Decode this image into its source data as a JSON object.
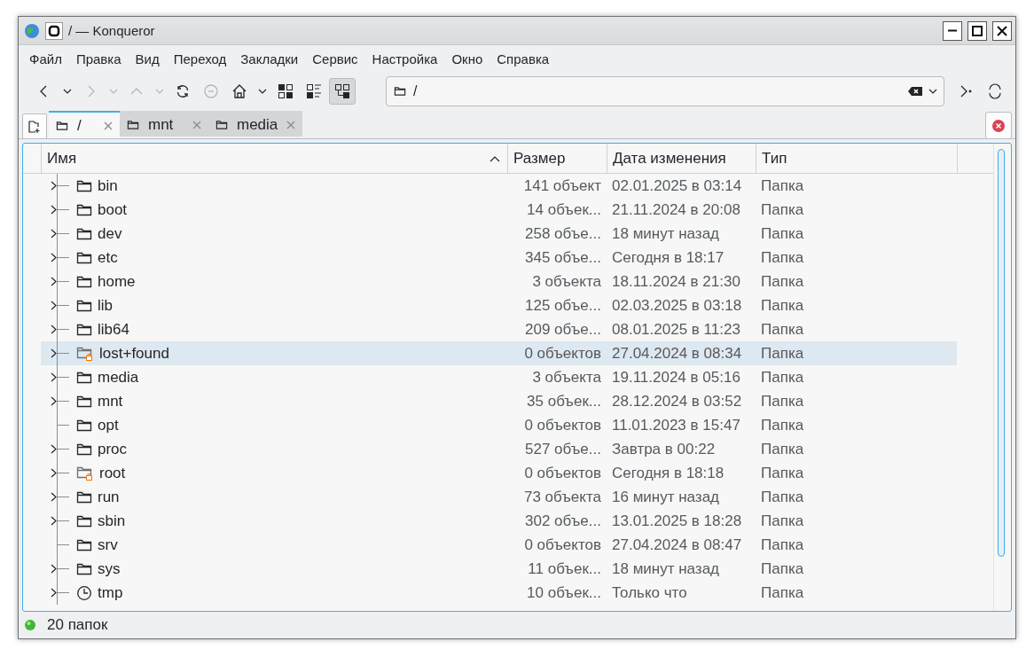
{
  "window": {
    "title": "/ — Konqueror"
  },
  "menu": [
    "Файл",
    "Правка",
    "Вид",
    "Переход",
    "Закладки",
    "Сервис",
    "Настройка",
    "Окно",
    "Справка"
  ],
  "toolbar": [
    {
      "kind": "back",
      "disabled": false,
      "selected": false
    },
    {
      "kind": "dropdown",
      "disabled": false,
      "selected": false
    },
    {
      "kind": "forward",
      "disabled": true,
      "selected": false
    },
    {
      "kind": "dropdown",
      "disabled": true,
      "selected": false
    },
    {
      "kind": "up",
      "disabled": true,
      "selected": false
    },
    {
      "kind": "dropdown",
      "disabled": true,
      "selected": false
    },
    {
      "kind": "reload",
      "disabled": false,
      "selected": false
    },
    {
      "kind": "stop",
      "disabled": true,
      "selected": false
    },
    {
      "kind": "home",
      "disabled": false,
      "selected": false
    },
    {
      "kind": "dropdown",
      "disabled": false,
      "selected": false
    },
    {
      "kind": "icons",
      "disabled": false,
      "selected": false
    },
    {
      "kind": "details",
      "disabled": false,
      "selected": false
    },
    {
      "kind": "tree",
      "disabled": false,
      "selected": true
    }
  ],
  "location": {
    "value": "/"
  },
  "tabs": [
    {
      "label": "/",
      "selected": true
    },
    {
      "label": "mnt",
      "selected": false
    },
    {
      "label": "media",
      "selected": false
    }
  ],
  "table": {
    "columns": [
      "Имя",
      "Размер",
      "Дата изменения",
      "Тип"
    ],
    "rows": [
      {
        "name": "bin",
        "kind": "folder",
        "expandable": true,
        "selected": false,
        "size": "141 объект",
        "date": "02.01.2025 в 03:14",
        "type": "Папка"
      },
      {
        "name": "boot",
        "kind": "folder",
        "expandable": true,
        "selected": false,
        "size": "14 объек...",
        "date": "21.11.2024 в 20:08",
        "type": "Папка"
      },
      {
        "name": "dev",
        "kind": "folder",
        "expandable": true,
        "selected": false,
        "size": "258 объе...",
        "date": "18 минут назад",
        "type": "Папка"
      },
      {
        "name": "etc",
        "kind": "folder",
        "expandable": true,
        "selected": false,
        "size": "345 объе...",
        "date": "Сегодня в 18:17",
        "type": "Папка"
      },
      {
        "name": "home",
        "kind": "folder",
        "expandable": true,
        "selected": false,
        "size": "3 объекта",
        "date": "18.11.2024 в 21:30",
        "type": "Папка"
      },
      {
        "name": "lib",
        "kind": "folder",
        "expandable": true,
        "selected": false,
        "size": "125 объе...",
        "date": "02.03.2025 в 03:18",
        "type": "Папка"
      },
      {
        "name": "lib64",
        "kind": "folder",
        "expandable": true,
        "selected": false,
        "size": "209 объе...",
        "date": "08.01.2025 в 11:23",
        "type": "Папка"
      },
      {
        "name": "lost+found",
        "kind": "locked",
        "expandable": true,
        "selected": true,
        "size": "0 объектов",
        "date": "27.04.2024 в 08:34",
        "type": "Папка"
      },
      {
        "name": "media",
        "kind": "folder",
        "expandable": true,
        "selected": false,
        "size": "3 объекта",
        "date": "19.11.2024 в 05:16",
        "type": "Папка"
      },
      {
        "name": "mnt",
        "kind": "folder",
        "expandable": true,
        "selected": false,
        "size": "35 объек...",
        "date": "28.12.2024 в 03:52",
        "type": "Папка"
      },
      {
        "name": "opt",
        "kind": "folder",
        "expandable": false,
        "selected": false,
        "size": "0 объектов",
        "date": "11.01.2023 в 15:47",
        "type": "Папка"
      },
      {
        "name": "proc",
        "kind": "folder",
        "expandable": true,
        "selected": false,
        "size": "527 объе...",
        "date": "Завтра в 00:22",
        "type": "Папка"
      },
      {
        "name": "root",
        "kind": "locked",
        "expandable": true,
        "selected": false,
        "size": "0 объектов",
        "date": "Сегодня в 18:18",
        "type": "Папка"
      },
      {
        "name": "run",
        "kind": "folder",
        "expandable": true,
        "selected": false,
        "size": "73 объекта",
        "date": "16 минут назад",
        "type": "Папка"
      },
      {
        "name": "sbin",
        "kind": "folder",
        "expandable": true,
        "selected": false,
        "size": "302 объе...",
        "date": "13.01.2025 в 18:28",
        "type": "Папка"
      },
      {
        "name": "srv",
        "kind": "folder",
        "expandable": false,
        "selected": false,
        "size": "0 объектов",
        "date": "27.04.2024 в 08:47",
        "type": "Папка"
      },
      {
        "name": "sys",
        "kind": "folder",
        "expandable": true,
        "selected": false,
        "size": "11 объек...",
        "date": "18 минут назад",
        "type": "Папка"
      },
      {
        "name": "tmp",
        "kind": "clock",
        "expandable": true,
        "selected": false,
        "size": "10 объек...",
        "date": "Только что",
        "type": "Папка"
      }
    ]
  },
  "status_bar": {
    "text": "20 папок"
  }
}
